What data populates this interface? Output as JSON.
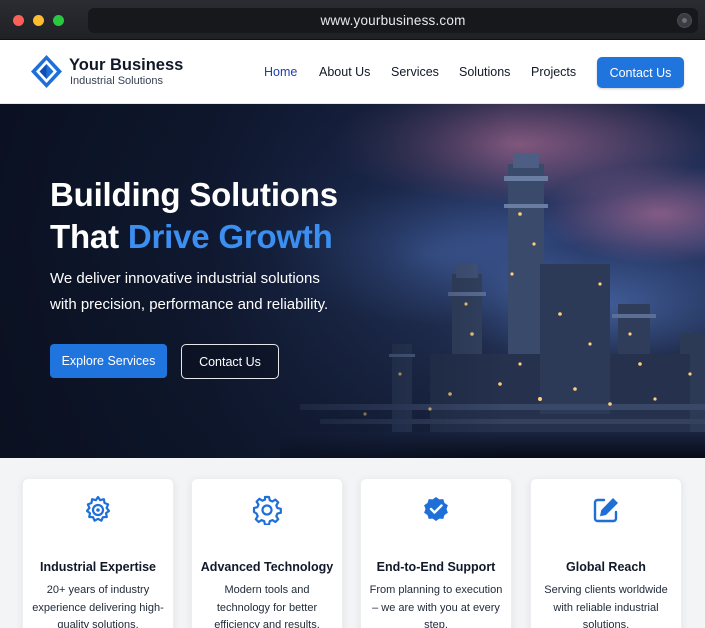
{
  "browser": {
    "url": "www.yourbusiness.com"
  },
  "brand": {
    "name": "Your Business",
    "tagline": "Industrial Solutions",
    "logo_icon": "diamond-logo-icon",
    "color": "#1f74de"
  },
  "nav": {
    "items": [
      {
        "label": "Home",
        "active": true
      },
      {
        "label": "About Us",
        "active": false
      },
      {
        "label": "Services",
        "active": false
      },
      {
        "label": "Solutions",
        "active": false
      },
      {
        "label": "Projects",
        "active": false
      }
    ],
    "cta_label": "Contact Us"
  },
  "hero": {
    "title_line1": "Building Solutions",
    "title_line2_prefix": "That ",
    "title_line2_accent": "Drive Growth",
    "subtitle": "We deliver innovative industrial solutions with precision, performance and reliability.",
    "primary_button": "Explore Services",
    "secondary_button": "Contact Us",
    "accent_color": "#3b8ff0"
  },
  "features": [
    {
      "icon": "gear-target-icon",
      "title": "Industrial Expertise",
      "text": "20+ years of industry experience delivering high-quality solutions."
    },
    {
      "icon": "gear-icon",
      "title": "Advanced Technology",
      "text": "Modern tools and technology for better efficiency and results."
    },
    {
      "icon": "badge-icon",
      "title": "End-to-End Support",
      "text": "From planning to execution – we are with you at every step."
    },
    {
      "icon": "edit-icon",
      "title": "Global Reach",
      "text": "Serving clients worldwide with reliable industrial solutions."
    }
  ]
}
